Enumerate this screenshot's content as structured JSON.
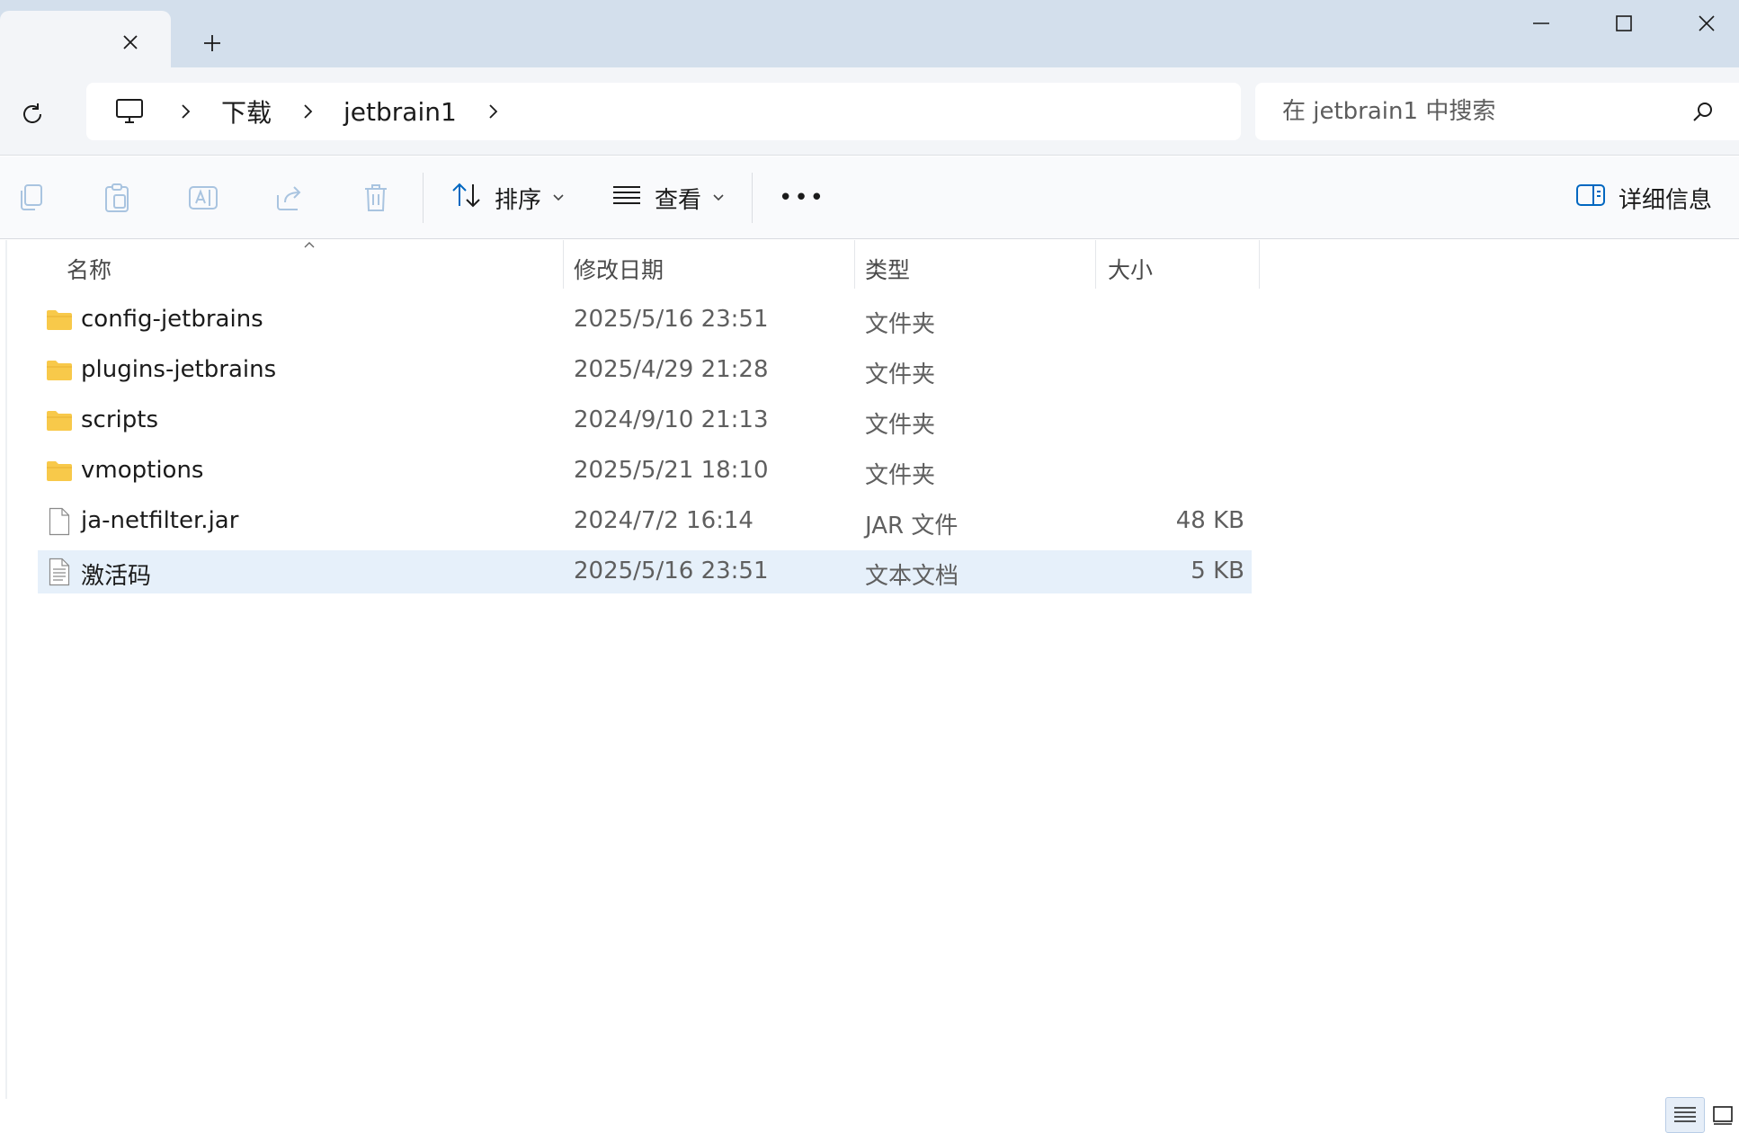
{
  "window": {
    "tab_close_icon": "close-icon",
    "new_tab_icon": "plus-icon",
    "controls": [
      "minimize-icon",
      "maximize-icon",
      "close-icon"
    ]
  },
  "address": {
    "root_icon": "computer-icon",
    "segments": [
      "下载",
      "jetbrain1"
    ],
    "search_placeholder": "在 jetbrain1 中搜索"
  },
  "toolbar": {
    "sort_label": "排序",
    "view_label": "查看",
    "more_label": "•••",
    "details_label": "详细信息",
    "disabled_actions": [
      "copy-icon",
      "paste-icon",
      "rename-icon",
      "share-icon",
      "delete-icon"
    ]
  },
  "columns": {
    "name": "名称",
    "date": "修改日期",
    "type": "类型",
    "size": "大小"
  },
  "files": [
    {
      "icon": "folder-icon",
      "name": "config-jetbrains",
      "date": "2025/5/16 23:51",
      "type": "文件夹",
      "size": ""
    },
    {
      "icon": "folder-icon",
      "name": "plugins-jetbrains",
      "date": "2025/4/29 21:28",
      "type": "文件夹",
      "size": ""
    },
    {
      "icon": "folder-icon",
      "name": "scripts",
      "date": "2024/9/10 21:13",
      "type": "文件夹",
      "size": ""
    },
    {
      "icon": "folder-icon",
      "name": "vmoptions",
      "date": "2025/5/21 18:10",
      "type": "文件夹",
      "size": ""
    },
    {
      "icon": "file-icon",
      "name": "ja-netfilter.jar",
      "date": "2024/7/2 16:14",
      "type": "JAR 文件",
      "size": "48 KB"
    },
    {
      "icon": "text-file-icon",
      "name": "激活码",
      "date": "2025/5/16 23:51",
      "type": "文本文档",
      "size": "5 KB",
      "selected": true
    }
  ],
  "colors": {
    "titlebar": "#d3dfec",
    "selection": "#e6f0fa",
    "folder": "#f8c94a",
    "accent": "#0067c0"
  }
}
